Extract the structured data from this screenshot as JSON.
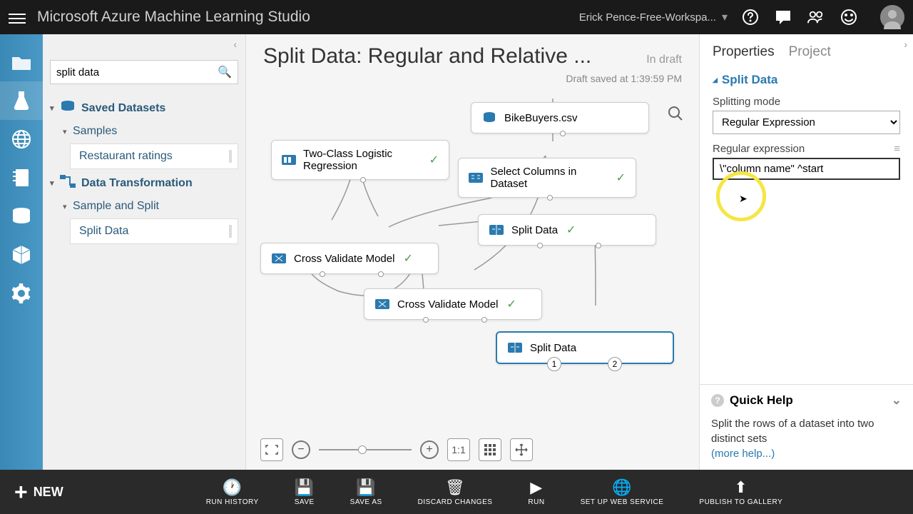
{
  "header": {
    "app_title": "Microsoft Azure Machine Learning Studio",
    "workspace": "Erick Pence-Free-Workspa..."
  },
  "left_panel": {
    "search_value": "split data",
    "tree": {
      "saved_datasets": "Saved Datasets",
      "samples": "Samples",
      "restaurant_ratings": "Restaurant ratings",
      "data_transformation": "Data Transformation",
      "sample_and_split": "Sample and Split",
      "split_data": "Split Data"
    }
  },
  "canvas": {
    "title": "Split Data: Regular and Relative ...",
    "status": "In draft",
    "saved_meta": "Draft saved at 1:39:59 PM",
    "modules": {
      "bike_buyers": "BikeBuyers.csv",
      "logistic_regression": "Two-Class Logistic Regression",
      "select_columns": "Select Columns in Dataset",
      "split_data_1": "Split Data",
      "cross_validate_1": "Cross Validate Model",
      "cross_validate_2": "Cross Validate Model",
      "split_data_2": "Split Data"
    },
    "port1": "1",
    "port2": "2",
    "zoom_reset_label": "1:1"
  },
  "properties": {
    "tab_properties": "Properties",
    "tab_project": "Project",
    "section_title": "Split Data",
    "splitting_mode_label": "Splitting mode",
    "splitting_mode_value": "Regular Expression",
    "regex_label": "Regular expression",
    "regex_value": "\\\"column name\" ^start"
  },
  "quick_help": {
    "title": "Quick Help",
    "body": "Split the rows of a dataset into two distinct sets",
    "link": "(more help...)"
  },
  "bottom": {
    "new": "NEW",
    "run_history": "RUN HISTORY",
    "save": "SAVE",
    "save_as": "SAVE AS",
    "discard": "DISCARD CHANGES",
    "run": "RUN",
    "web_service": "SET UP WEB SERVICE",
    "publish": "PUBLISH TO GALLERY"
  }
}
